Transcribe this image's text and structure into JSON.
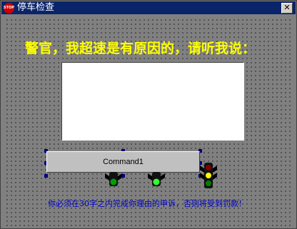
{
  "window": {
    "title": "停车检查",
    "icon_label": "STOP",
    "close_glyph": "✕"
  },
  "main": {
    "heading": "警官，我超速是有原因的，请听我说：",
    "reason_text": "",
    "command_label": "Command1",
    "notice": "你必须在30字之内完成你理由的申诉，否则将受到罚款！"
  },
  "colors": {
    "heading": "#ffff00",
    "notice": "#0000cc",
    "titlebar": "#0a246a",
    "client_bg": "#808080"
  },
  "icons": {
    "traffic_lights": [
      "traffic-light-green-icon",
      "traffic-light-green-lit-icon",
      "traffic-light-yellow-icon"
    ]
  }
}
